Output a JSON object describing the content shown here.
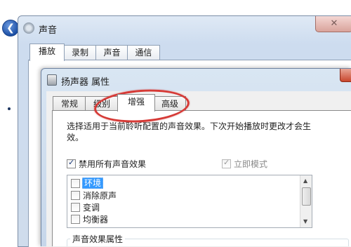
{
  "background": {},
  "sound_window": {
    "title": "声音",
    "close_glyph": "✕",
    "tabs": [
      {
        "label": "播放",
        "active": true
      },
      {
        "label": "录制",
        "active": false
      },
      {
        "label": "声音",
        "active": false
      },
      {
        "label": "通信",
        "active": false
      }
    ]
  },
  "dialog": {
    "title": "扬声器 属性",
    "tabs": [
      {
        "label": "常规",
        "active": false
      },
      {
        "label": "级别",
        "active": false
      },
      {
        "label": "增强",
        "active": true
      },
      {
        "label": "高级",
        "active": false
      }
    ],
    "description": "选择适用于当前聆听配置的声音效果。下次开始播放时更改才会生效。",
    "disable_all": {
      "label": "禁用所有声音效果",
      "checked": true
    },
    "immediate_mode": {
      "label": "立即模式",
      "checked": true,
      "enabled": false
    },
    "effects": [
      {
        "label": "环境",
        "checked": false,
        "selected": true
      },
      {
        "label": "消除原声",
        "checked": false,
        "selected": false
      },
      {
        "label": "变调",
        "checked": false,
        "selected": false
      },
      {
        "label": "均衡器",
        "checked": false,
        "selected": false
      }
    ],
    "group_label": "声音效果属性"
  },
  "colors": {
    "highlight": "#d63a36",
    "selection": "#3399ff"
  }
}
